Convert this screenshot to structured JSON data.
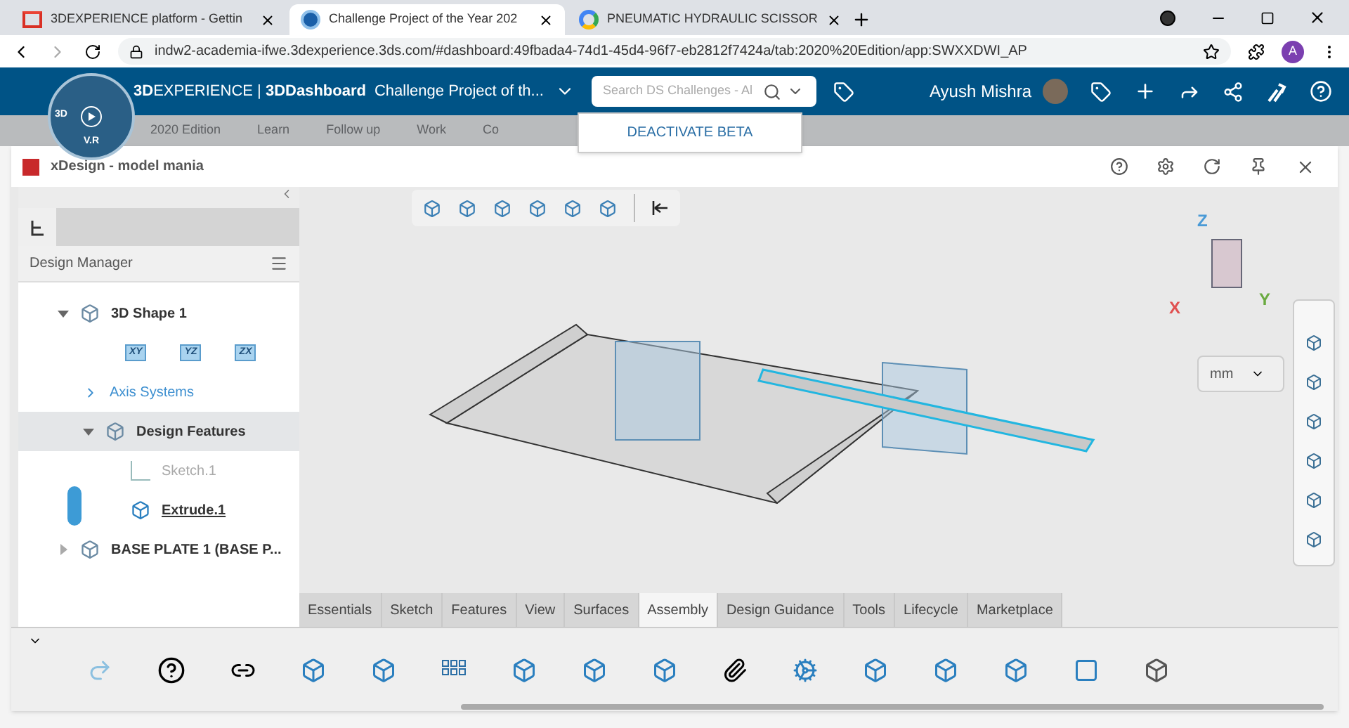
{
  "browser_tabs": [
    {
      "title": "3DEXPERIENCE platform - Gettin",
      "selected": false,
      "kind": "gmail"
    },
    {
      "title": "Challenge Project of the Year 202",
      "selected": true,
      "kind": "globe"
    },
    {
      "title": "PNEUMATIC HYDRAULIC SCISSOR",
      "selected": false,
      "kind": "google"
    }
  ],
  "address": "indw2-academia-ifwe.3dexperience.3ds.com/#dashboard:49fbada4-74d1-45d4-96f7-eb2812f7424a/tab:2020%20Edition/app:SWXXDWI_AP",
  "profile_initial": "A",
  "topbar": {
    "brand_bold": "3D",
    "brand_rest": "EXPERIENCE | ",
    "app": "3DDashboard",
    "dashboard": "Challenge Project of th...",
    "search_placeholder": "Search DS Challenges - Al",
    "user": "Ayush Mishra"
  },
  "compass": {
    "left": "3D",
    "bottom": "V.R"
  },
  "beta_menu": {
    "item": "DEACTIVATE BETA"
  },
  "dashboard_tabs": [
    "2020 Edition",
    "Learn",
    "Follow up",
    "Work",
    "Co"
  ],
  "widget": {
    "title": "xDesign - model mania"
  },
  "panel": {
    "title": "Design Manager"
  },
  "tree": [
    {
      "label": "3D Shape 1",
      "kind": "node",
      "expanded": true,
      "selected": false,
      "children": [
        {
          "kind": "planes",
          "planes": [
            "XY",
            "YZ",
            "ZX"
          ]
        },
        {
          "label": "Axis Systems",
          "kind": "link",
          "expanded": false,
          "selected": false
        },
        {
          "label": "Design Features",
          "kind": "node",
          "expanded": true,
          "selected": true,
          "children": [
            {
              "label": "Sketch.1",
              "kind": "sketch",
              "hidden": true,
              "selected": false
            },
            {
              "label": "Extrude.1",
              "kind": "extrude",
              "hidden": false,
              "selected": false
            }
          ]
        }
      ]
    },
    {
      "label": "BASE PLATE 1 (BASE P...",
      "kind": "node",
      "expanded": false,
      "selected": false
    }
  ],
  "triad": {
    "z": "Z",
    "x": "X",
    "y": "Y"
  },
  "units": "mm",
  "ribbon_tabs": [
    {
      "label": "Essentials",
      "selected": false
    },
    {
      "label": "Sketch",
      "selected": false
    },
    {
      "label": "Features",
      "selected": false
    },
    {
      "label": "View",
      "selected": false
    },
    {
      "label": "Surfaces",
      "selected": false
    },
    {
      "label": "Assembly",
      "selected": true
    },
    {
      "label": "Design Guidance",
      "selected": false
    },
    {
      "label": "Tools",
      "selected": false
    },
    {
      "label": "Lifecycle",
      "selected": false
    },
    {
      "label": "Marketplace",
      "selected": false
    }
  ]
}
